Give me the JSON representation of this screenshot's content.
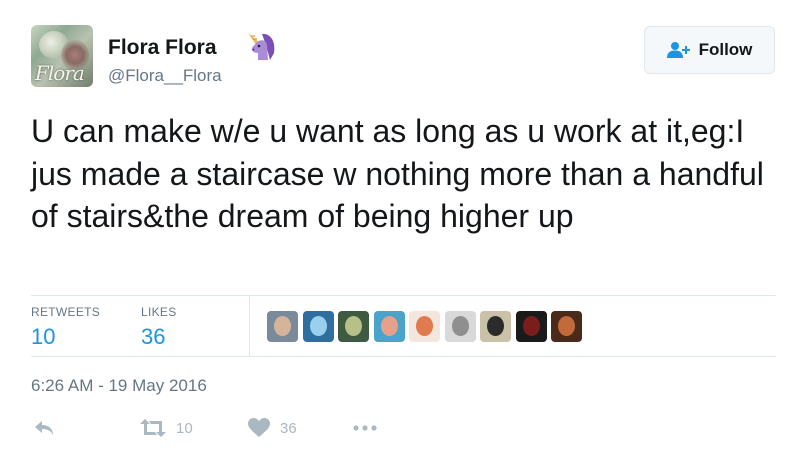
{
  "user": {
    "display_name": "Flora Flora",
    "emoji_icon": "unicorn-icon",
    "handle": "@Flora__Flora",
    "avatar_text": "Flora"
  },
  "follow_button": {
    "label": "Follow",
    "icon": "add-user-icon"
  },
  "tweet": {
    "text": "U can make w/e u want as long as u work at it,eg:I jus made a staircase w nothing more than a handful of stairs&the dream of being higher up",
    "timestamp": "6:26 AM - 19 May 2016"
  },
  "stats": {
    "retweets_label": "RETWEETS",
    "retweets_value": "10",
    "likes_label": "LIKES",
    "likes_value": "36"
  },
  "likers": [
    {
      "icon": "liker-avatar-1"
    },
    {
      "icon": "liker-avatar-2"
    },
    {
      "icon": "liker-avatar-3"
    },
    {
      "icon": "liker-avatar-4"
    },
    {
      "icon": "liker-avatar-5"
    },
    {
      "icon": "liker-avatar-6"
    },
    {
      "icon": "liker-avatar-7"
    },
    {
      "icon": "liker-avatar-8"
    },
    {
      "icon": "liker-avatar-9"
    }
  ],
  "actions": {
    "reply_icon": "reply-icon",
    "retweet_icon": "retweet-icon",
    "retweet_count": "10",
    "like_icon": "heart-icon",
    "like_count": "36",
    "more_icon": "more-icon"
  },
  "colors": {
    "link_blue": "#1b95e0",
    "muted_gray": "#657786",
    "action_gray": "#aab8c2",
    "divider": "#e1e8ed"
  }
}
